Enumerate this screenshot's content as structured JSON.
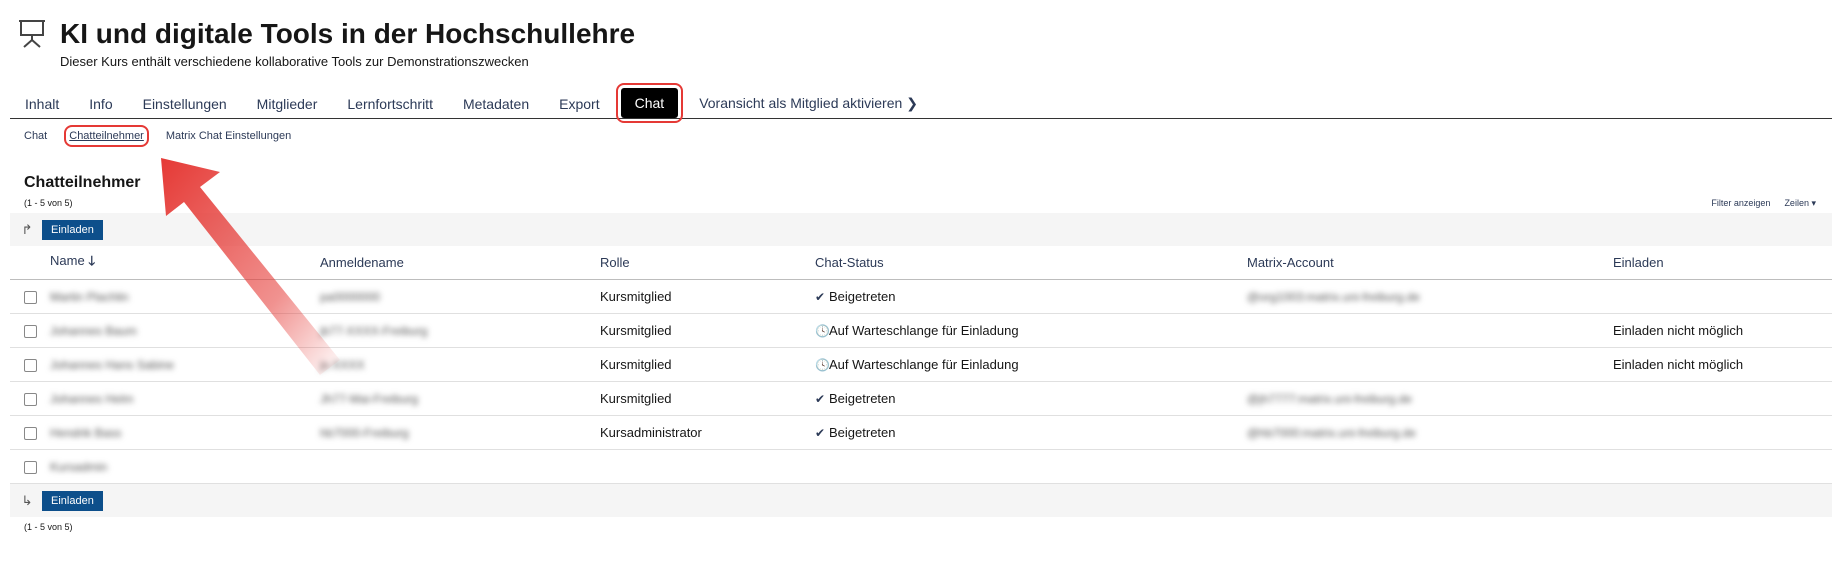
{
  "header": {
    "title": "KI und digitale Tools in der Hochschullehre",
    "description": "Dieser Kurs enthält verschiedene kollaborative Tools zur Demonstrationszwecken",
    "icon": "presentation-board-icon"
  },
  "tabs": [
    {
      "label": "Inhalt"
    },
    {
      "label": "Info"
    },
    {
      "label": "Einstellungen"
    },
    {
      "label": "Mitglieder"
    },
    {
      "label": "Lernfortschritt"
    },
    {
      "label": "Metadaten"
    },
    {
      "label": "Export"
    },
    {
      "label": "Chat",
      "active": true
    },
    {
      "label": "Voransicht als Mitglied aktivieren"
    }
  ],
  "subtabs": [
    {
      "label": "Chat"
    },
    {
      "label": "Chatteilnehmer",
      "active": true
    },
    {
      "label": "Matrix Chat Einstellungen"
    }
  ],
  "section": {
    "title": "Chatteilnehmer",
    "count": "(1 - 5 von 5)",
    "filter_label": "Filter anzeigen",
    "rows_label": "Zeilen"
  },
  "actions": {
    "invite_label": "Einladen"
  },
  "table": {
    "columns": [
      "Name",
      "Anmeldename",
      "Rolle",
      "Chat-Status",
      "Matrix-Account",
      "Einladen"
    ],
    "rows": [
      {
        "name": "Martin Plachlin",
        "login": "pa0000000",
        "role": "Kursmitglied",
        "status": "Beigetreten",
        "status_icon": "check",
        "matrix": "@org1003:matrix.uni-freiburg.de",
        "invite": ""
      },
      {
        "name": "Johannes Baum",
        "login": "jb77-XXXX-Freiburg",
        "role": "Kursmitglied",
        "status": "Auf Warteschlange für Einladung",
        "status_icon": "clock",
        "matrix": "",
        "invite": "Einladen nicht möglich"
      },
      {
        "name": "Johannes Hans Sabine",
        "login": "js-XXXX",
        "role": "Kursmitglied",
        "status": "Auf Warteschlange für Einladung",
        "status_icon": "clock",
        "matrix": "",
        "invite": "Einladen nicht möglich"
      },
      {
        "name": "Johannes Helm",
        "login": "Jh77-Mai-Freiburg",
        "role": "Kursmitglied",
        "status": "Beigetreten",
        "status_icon": "check",
        "matrix": "@jh7777:matrix.uni-freiburg.de",
        "invite": ""
      },
      {
        "name": "Hendrik Bass",
        "login": "hb7000-Freiburg",
        "role": "Kursadministrator",
        "status": "Beigetreten",
        "status_icon": "check",
        "matrix": "@hb7000:matrix.uni-freiburg.de",
        "invite": ""
      },
      {
        "name": "Kursadmin",
        "login": "",
        "role": "",
        "status": "",
        "status_icon": "",
        "matrix": "",
        "invite": ""
      }
    ]
  },
  "colors": {
    "link": "#2c3a57",
    "button": "#0d4f8b",
    "highlight": "#e53935"
  }
}
